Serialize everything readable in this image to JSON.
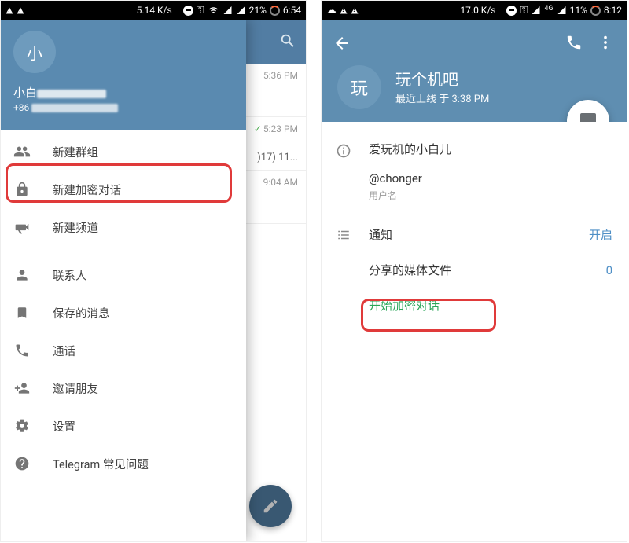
{
  "left": {
    "statusbar": {
      "speed": "5.14 K/s",
      "battery": "21%",
      "time": "6:54"
    },
    "drawer": {
      "avatar_letter": "小",
      "name_visible": "小白",
      "phone_prefix": "+86",
      "items": {
        "new_group": "新建群组",
        "new_secret_chat": "新建加密对话",
        "new_channel": "新建频道",
        "contacts": "联系人",
        "saved": "保存的消息",
        "calls": "通话",
        "invite": "邀请朋友",
        "settings": "设置",
        "faq": "Telegram 常见问题"
      }
    },
    "chatlist": [
      {
        "time": "5:36 PM",
        "line2": "",
        "check": false
      },
      {
        "time": "5:23 PM",
        "line2": ")17) 11...",
        "check": true
      },
      {
        "time": "9:04 AM",
        "line2": "",
        "check": false
      }
    ]
  },
  "right": {
    "statusbar": {
      "speed": "17.0 K/s",
      "network_label": "4G",
      "battery": "11%",
      "time": "8:12"
    },
    "profile": {
      "avatar_letter": "玩",
      "name": "玩个机吧",
      "status": "最近上线 于 3:38 PM"
    },
    "info": {
      "bio": "爱玩机的小白儿",
      "username": "@chonger",
      "username_label": "用户名"
    },
    "rows": {
      "notifications_label": "通知",
      "notifications_value": "开启",
      "shared_media_label": "分享的媒体文件",
      "shared_media_value": "0",
      "start_secret_chat": "开始加密对话"
    }
  }
}
